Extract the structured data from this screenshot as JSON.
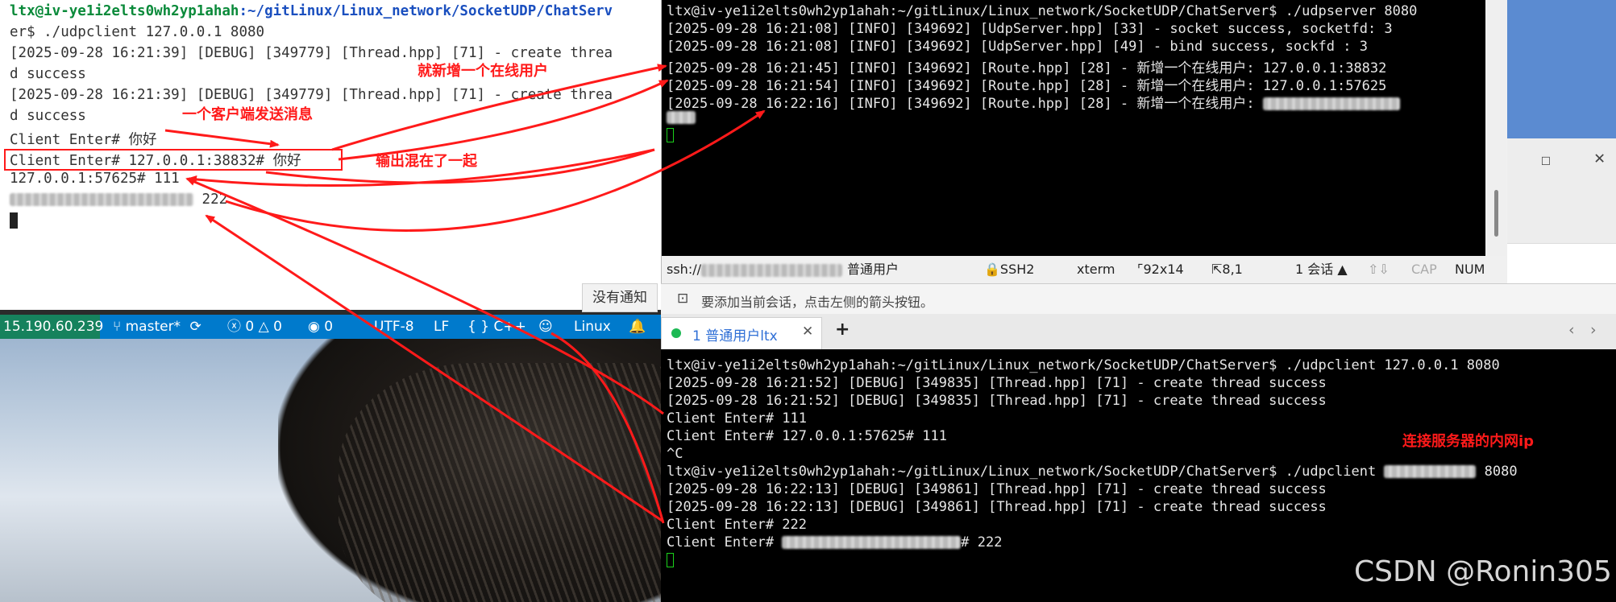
{
  "left_terminal": {
    "line1_user": "ltx@iv-ye1i2elts0wh2yp1ahah",
    "line1_path": ":~/gitLinux/Linux_network/SocketUDP/ChatServ",
    "line2": "er$ ./udpclient 127.0.0.1 8080",
    "line3": "[2025-09-28 16:21:39] [DEBUG] [349779] [Thread.hpp] [71] - create threa",
    "line4": "d success",
    "line5": "[2025-09-28 16:21:39] [DEBUG] [349779] [Thread.hpp] [71] - create threa",
    "line6": "d success",
    "line7": "Client Enter# 你好",
    "line8": "Client Enter# 127.0.0.1:38832# 你好",
    "line9": "127.0.0.1:57625# 111",
    "line10_tail": " 222",
    "notification": "没有通知"
  },
  "statusbar": {
    "remote": "15.190.60.239",
    "branch": "master*",
    "errors": "0",
    "warnings": "0",
    "ports": "0",
    "encoding": "UTF-8",
    "eol": "LF",
    "language": "C++",
    "os": "Linux"
  },
  "xshell_top": {
    "lines": [
      "ltx@iv-ye1i2elts0wh2yp1ahah:~/gitLinux/Linux_network/SocketUDP/ChatServer$ ./udpserver 8080",
      "[2025-09-28 16:21:08] [INFO] [349692] [UdpServer.hpp] [33] - socket success, socketfd: 3",
      "[2025-09-28 16:21:08] [INFO] [349692] [UdpServer.hpp] [49] - bind success, sockfd : 3",
      "[2025-09-28 16:21:45] [INFO] [349692] [Route.hpp] [28] - 新增一个在线用户: 127.0.0.1:38832",
      "[2025-09-28 16:21:54] [INFO] [349692] [Route.hpp] [28] - 新增一个在线用户: 127.0.0.1:57625",
      "[2025-09-28 16:22:16] [INFO] [349692] [Route.hpp] [28] - 新增一个在线用户: "
    ],
    "status": {
      "ssh_prefix": "ssh://",
      "ssh_suffix": "普通用户",
      "protocol": "SSH2",
      "term": "xterm",
      "size": "92x14",
      "pos": "8,1",
      "sessions": "1 会话",
      "cap": "CAP",
      "num": "NUM"
    }
  },
  "xshell_bottom": {
    "hint": "要添加当前会话，点击左侧的箭头按钮。",
    "tab_label": "1 普通用户ltx",
    "add_tab": "+",
    "lines": [
      "ltx@iv-ye1i2elts0wh2yp1ahah:~/gitLinux/Linux_network/SocketUDP/ChatServer$ ./udpclient 127.0.0.1 8080",
      "[2025-09-28 16:21:52] [DEBUG] [349835] [Thread.hpp] [71] - create thread success",
      "[2025-09-28 16:21:52] [DEBUG] [349835] [Thread.hpp] [71] - create thread success",
      "Client Enter# 111",
      "Client Enter# 127.0.0.1:57625# 111",
      "^C"
    ],
    "line7_pre": "ltx@iv-ye1i2elts0wh2yp1ahah:~/gitLinux/Linux_network/SocketUDP/ChatServer$ ./udpclient ",
    "line7_post": " 8080",
    "line8": "[2025-09-28 16:22:13] [DEBUG] [349861] [Thread.hpp] [71] - create thread success",
    "line9": "[2025-09-28 16:22:13] [DEBUG] [349861] [Thread.hpp] [71] - create thread success",
    "line10": "Client Enter# 222",
    "line11_pre": "Client Enter# ",
    "line11_post": "# 222"
  },
  "annotations": {
    "new_user": "就新增一个在线用户",
    "one_client_send": "一个客户端发送消息",
    "mixed_output": "输出混在了一起",
    "intranet_ip": "连接服务器的内网ip"
  },
  "watermark": "CSDN @Ronin305",
  "colors": {
    "annotation": "#ff1a1a",
    "statusbar": "#007acc",
    "remote_badge": "#16825d",
    "terminal_bg": "#000000"
  }
}
